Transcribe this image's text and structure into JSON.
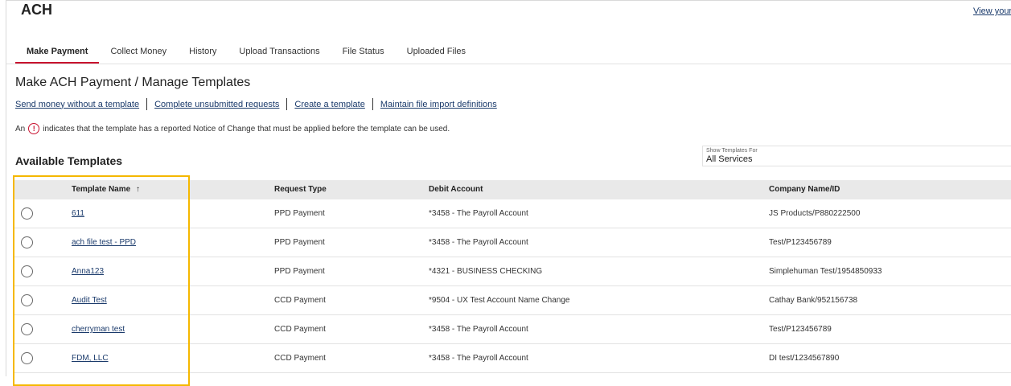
{
  "app": {
    "title": "ACH",
    "top_link": "View your A"
  },
  "tabs": [
    {
      "label": "Make Payment",
      "active": true
    },
    {
      "label": "Collect Money"
    },
    {
      "label": "History"
    },
    {
      "label": "Upload Transactions"
    },
    {
      "label": "File Status"
    },
    {
      "label": "Uploaded Files"
    }
  ],
  "section": {
    "title": "Make ACH Payment / Manage Templates",
    "links": [
      "Send money without a template",
      "Complete unsubmitted requests",
      "Create a template",
      "Maintain file import definitions"
    ],
    "notice_prefix": "An",
    "notice_icon": "!",
    "notice_text": "indicates that the template has a reported Notice of Change that must be applied before the template can be used."
  },
  "templates": {
    "title": "Available Templates",
    "filter_label": "Show Templates For",
    "filter_value": "All Services",
    "columns": {
      "name": "Template Name",
      "sort_icon": "↑",
      "type": "Request Type",
      "debit": "Debit Account",
      "company": "Company Name/ID"
    },
    "rows": [
      {
        "name": "611",
        "type": "PPD Payment",
        "debit": "*3458 - The Payroll Account",
        "company": "JS Products/P880222500"
      },
      {
        "name": "ach file test - PPD",
        "type": "PPD Payment",
        "debit": "*3458 - The Payroll Account",
        "company": "Test/P123456789"
      },
      {
        "name": "Anna123",
        "type": "PPD Payment",
        "debit": "*4321 - BUSINESS CHECKING",
        "company": "Simplehuman Test/1954850933"
      },
      {
        "name": "Audit Test",
        "type": "CCD Payment",
        "debit": "*9504 - UX Test Account Name Change",
        "company": "Cathay Bank/952156738"
      },
      {
        "name": "cherryman test",
        "type": "CCD Payment",
        "debit": "*3458 - The Payroll Account",
        "company": "Test/P123456789"
      },
      {
        "name": "FDM, LLC",
        "type": "CCD Payment",
        "debit": "*3458 - The Payroll Account",
        "company": "DI test/1234567890"
      }
    ]
  },
  "colors": {
    "accent_red": "#c8102e",
    "link_blue": "#1a3a6b",
    "highlight_yellow": "#f5b800",
    "header_gray": "#e9e9e9"
  }
}
